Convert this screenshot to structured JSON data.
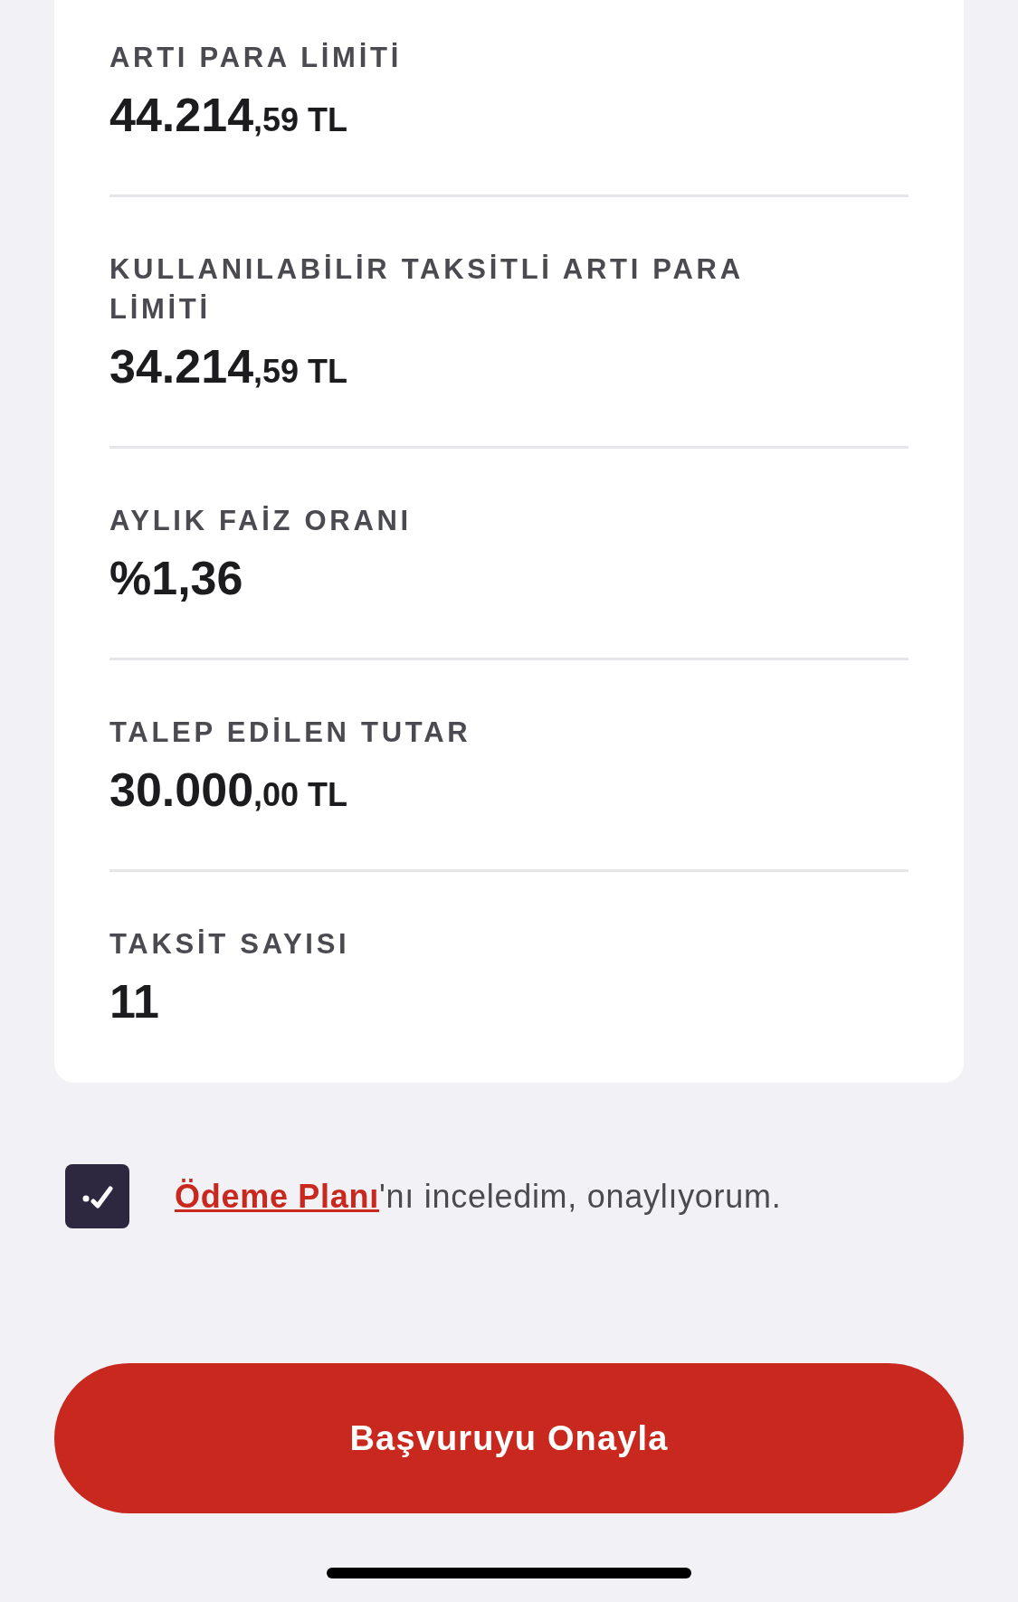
{
  "details": [
    {
      "label": "ARTI PARA LİMİTİ",
      "value_main": "44.214",
      "value_rest": ",59 TL"
    },
    {
      "label": "KULLANILABİLİR TAKSİTLİ ARTI PARA LİMİTİ",
      "value_main": "34.214",
      "value_rest": ",59 TL"
    },
    {
      "label": "AYLIK FAİZ ORANI",
      "value_main": "%1,36"
    },
    {
      "label": "TALEP EDİLEN TUTAR",
      "value_main": "30.000",
      "value_rest": ",00 TL"
    },
    {
      "label": "TAKSİT SAYISI",
      "value_main": "11"
    }
  ],
  "consent": {
    "checked": true,
    "link": "Ödeme Planı",
    "text": "'nı inceledim, onaylıyorum."
  },
  "confirm_button": "Başvuruyu Onayla"
}
